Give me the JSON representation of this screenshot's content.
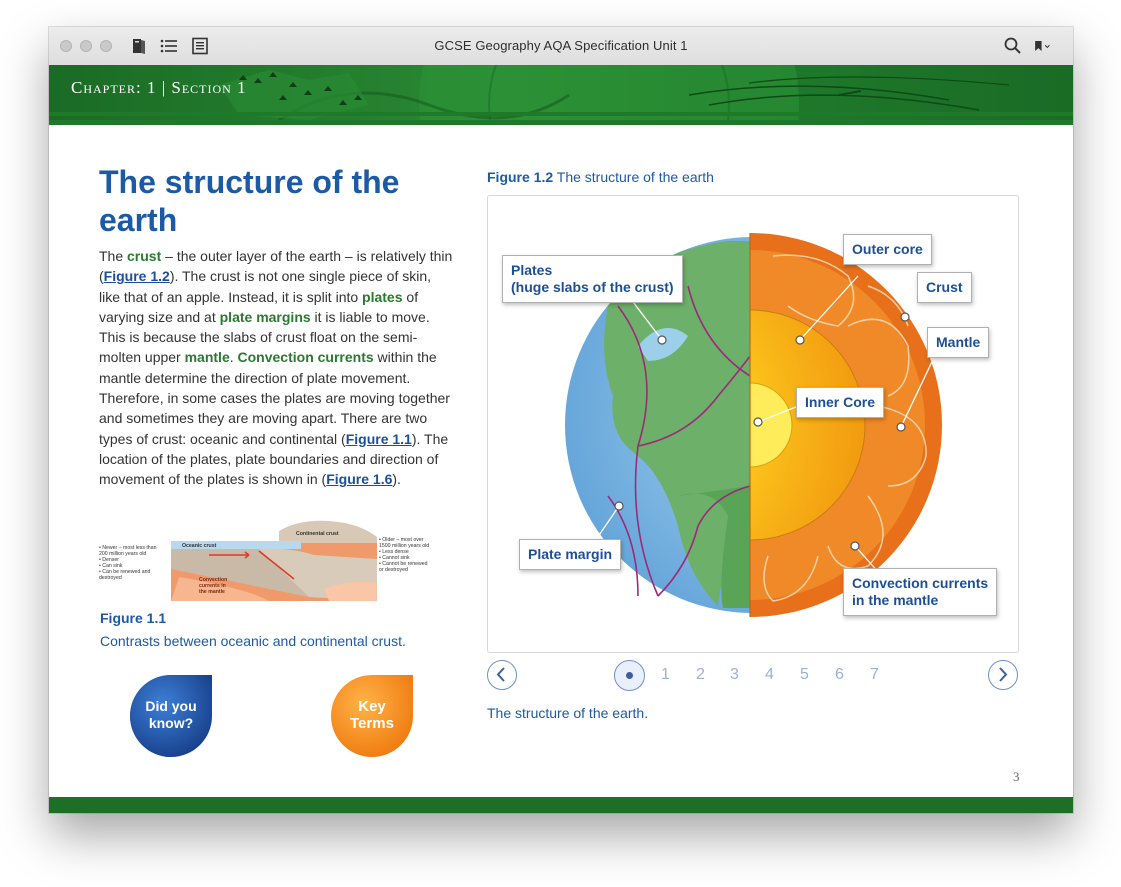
{
  "window": {
    "title": "GCSE  Geography  AQA Specification Unit 1",
    "toolbar_icons": [
      "library-icon",
      "toc-icon",
      "notes-icon",
      "search-icon",
      "bookmark-icon"
    ]
  },
  "banner": {
    "chapter_label": "Chapter: 1 | Section 1"
  },
  "article": {
    "heading": "The structure of the earth",
    "p1": "The ",
    "kw_crust": "crust",
    "p2": " – the outer layer of the earth – is relatively thin (",
    "link_fig12": "Figure 1.2",
    "p3": "). The crust is not one single piece of skin, like that of an apple. Instead, it is split into ",
    "kw_plates": "plates",
    "p4": " of varying size and at ",
    "kw_margins": "plate margins",
    "p5": " it is liable to move. This is because the slabs of crust float on the semi-molten upper ",
    "kw_mantle": "mantle",
    "p6": ". ",
    "kw_convection": "Convection currents",
    "p7": " within the mantle determine the direction of plate movement. Therefore, in some cases the plates are moving together and sometimes they are moving apart. There are two types of crust: oceanic and continental (",
    "link_fig11": "Figure 1.1",
    "p8": "). The location of the plates, plate boundaries and direction of movement of the plates is shown in (",
    "link_fig16": "Figure 1.6",
    "p9": ")."
  },
  "figure11": {
    "left_notes": [
      "• Newer – most less than",
      "  200 million years old",
      "• Denser",
      "• Can sink",
      "• Can be renewed and",
      "  destroyed"
    ],
    "right_notes": [
      "• Older – most over",
      "  1500 million years old",
      "• Less dense",
      "• Cannot sink",
      "• Cannot be renewed",
      "  or destroyed"
    ],
    "oceanic_label": "Oceanic crust",
    "continental_label": "Continental crust",
    "convection_lines": [
      "Convection",
      "currents in",
      "the mantle"
    ],
    "caption_num": "Figure 1.1",
    "caption_text": "Contrasts between oceanic and continental crust."
  },
  "badges": {
    "did_you_know": [
      "Did you",
      "know?"
    ],
    "key_terms": [
      "Key",
      "Terms"
    ]
  },
  "figure12": {
    "caption_num": "Figure 1.2",
    "caption_text": " The structure of the earth",
    "labels": {
      "plates_l1": "Plates",
      "plates_l2": "(huge slabs of the crust)",
      "outer_core": "Outer core",
      "crust": "Crust",
      "mantle": "Mantle",
      "inner_core": "Inner Core",
      "plate_margin": "Plate margin",
      "convection_l1": "Convection currents",
      "convection_l2": "in the mantle"
    }
  },
  "pager": {
    "pages": [
      "1",
      "2",
      "3",
      "4",
      "5",
      "6",
      "7"
    ],
    "current": 0
  },
  "bottom_caption": "The structure of the earth.",
  "page_number": "3",
  "colors": {
    "heading_blue": "#1c5aa6",
    "keyword_green": "#2a7a2f",
    "banner_green": "#1f7a2b"
  }
}
